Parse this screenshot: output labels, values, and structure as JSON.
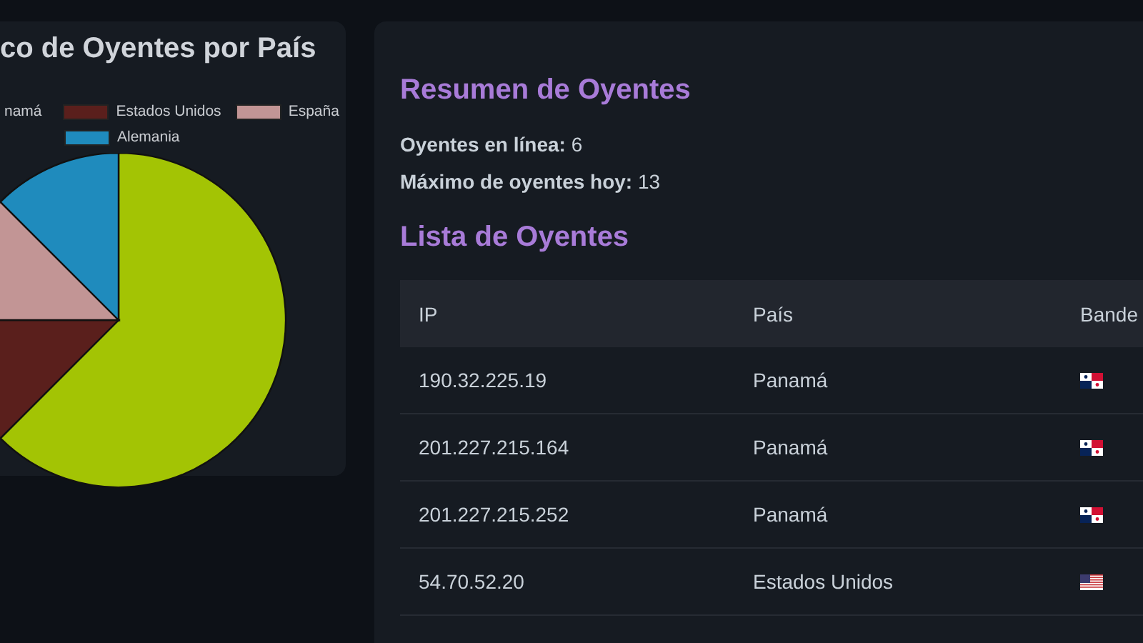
{
  "chart_card": {
    "title": "co de Oyentes por País",
    "chart_data": {
      "type": "pie",
      "categories": [
        "namá",
        "Estados Unidos",
        "España",
        "Alemania"
      ],
      "colors": [
        "#a3c404",
        "#5a1f1c",
        "#c29595",
        "#1f8bbd"
      ],
      "values": [
        62.5,
        12.5,
        12.5,
        12.5
      ]
    }
  },
  "summary": {
    "title": "Resumen de Oyentes",
    "stats": [
      {
        "label": "Oyentes en línea:",
        "value": "6"
      },
      {
        "label": "Máximo de oyentes hoy:",
        "value": "13"
      }
    ]
  },
  "list": {
    "title": "Lista de Oyentes",
    "columns": [
      "IP",
      "País",
      "Bande"
    ],
    "rows": [
      {
        "ip": "190.32.225.19",
        "country": "Panamá",
        "kind": "panama"
      },
      {
        "ip": "201.227.215.164",
        "country": "Panamá",
        "kind": "panama"
      },
      {
        "ip": "201.227.215.252",
        "country": "Panamá",
        "kind": "panama"
      },
      {
        "ip": "54.70.52.20",
        "country": "Estados Unidos",
        "kind": "usa"
      }
    ]
  }
}
